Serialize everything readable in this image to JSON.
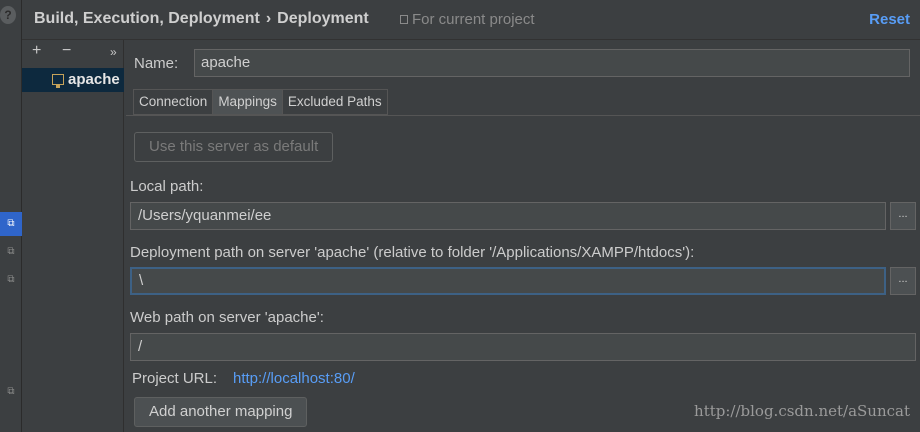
{
  "header": {
    "breadcrumb_parent": "Build, Execution, Deployment",
    "breadcrumb_separator": "›",
    "breadcrumb_current": "Deployment",
    "scope_label": "For current project",
    "reset_label": "Reset"
  },
  "servers": {
    "add_label": "+",
    "remove_label": "−",
    "more_label": "»",
    "items": [
      {
        "name": "apache",
        "selected": true
      }
    ]
  },
  "form": {
    "name_label": "Name:",
    "name_value": "apache",
    "tabs": [
      {
        "label": "Connection",
        "selected": false
      },
      {
        "label": "Mappings",
        "selected": true
      },
      {
        "label": "Excluded Paths",
        "selected": false
      }
    ],
    "default_button_label": "Use this server as default",
    "local_path_label": "Local path:",
    "local_path_value": "/Users/yquanmei/ee",
    "deployment_path_label": "Deployment path on server 'apache' (relative to folder '/Applications/XAMPP/htdocs'):",
    "deployment_path_value": "\\",
    "web_path_label": "Web path on server 'apache':",
    "web_path_value": "/",
    "browse_label": "...",
    "project_url_label": "Project URL:",
    "project_url_value": "http://localhost:80/",
    "add_mapping_label": "Add another mapping"
  },
  "watermark": "http://blog.csdn.net/aSuncat",
  "colors": {
    "background": "#3c3f41",
    "accent": "#589df6",
    "selection": "#0d293e",
    "focus": "#3d6185"
  },
  "icons": {
    "help": "help-icon",
    "scope": "project-scope-icon",
    "server": "server-icon"
  }
}
